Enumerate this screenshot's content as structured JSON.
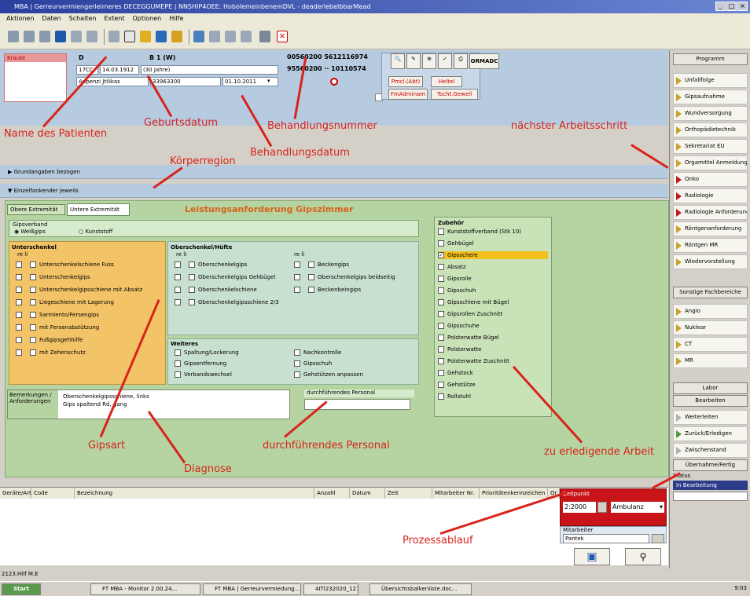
{
  "window": {
    "title": "MBA | Gerreurvermiengerleimeres DECEGGUMEPE | NNSHIP4OEE: HobolemeinbenemDVL - deaderlebelbbarMead",
    "buttons": [
      "_",
      "□",
      "×"
    ]
  },
  "menu": [
    "Aktionen",
    "Daten",
    "Schalten",
    "Extent",
    "Optionen",
    "Hilfe"
  ],
  "patient": {
    "label": "Kraute",
    "name_left": "D",
    "name_right": "B   1 (W)",
    "line2_a": "17CC",
    "line2_b": "14.03.1912",
    "line2_c": "(30 Jahre)",
    "line3_a": "Appenzi Jtilikas",
    "line3_b": "33963300",
    "line3_c": "01.10.2011",
    "case_1": "00560200 5612116974",
    "case_2": "95560200 ·· 10110574",
    "dropdown": "▾"
  },
  "header_buttons": [
    "Pmcl.(Abt)",
    "Heltel",
    "FmAdminam",
    "Tocht.Gewell"
  ],
  "ormadc_label": "ORMADC",
  "sections": {
    "collapsed": "Grundangaben bezogen",
    "expanded": "Einzelfankender jeweils"
  },
  "tabs": [
    "Obere Extremität",
    "Untere Extremität"
  ],
  "form_title": "Leistungsanforderung Gipszimmer",
  "gipsverband": {
    "label": "Gipsverband",
    "opt1": "Weißgips",
    "opt2": "Kunststoff"
  },
  "unterschenkel": {
    "title": "Unterschenkel",
    "cols": "re   li",
    "items": [
      "Unterschenkelschiene Fuss",
      "Unterschenkelgips",
      "Unterschenkelgipsschiene mit Absatz",
      "Liegeschiene mit Lagerung",
      "Sarmiento/Fersengips",
      "mit Fersenabstützung",
      "Fußgipsgehhilfe",
      "mit Zehenschutz"
    ]
  },
  "oberschenkel": {
    "title": "Oberschenkel/Hüfte",
    "cols_a": "re   li",
    "cols_b": "re   li",
    "left_items": [
      "Oberschenkelgips",
      "Oberschenkelgips Gehbügel",
      "Oberschenkelschiene",
      "Oberschenkelgipsschiene 2/3"
    ],
    "right_items": [
      "Beckengips",
      "Oberschenkelgips beidseitig",
      "Beckenbeingips"
    ]
  },
  "weitere": {
    "title": "Weiteres",
    "left_items": [
      "Spaltung/Lockerung",
      "Gipsentfernung",
      "Verbandswechsel"
    ],
    "right_items": [
      "Nachkontrolle",
      "Gipsschuh",
      "Gehstützen anpassen"
    ]
  },
  "zubehoer": {
    "title": "Zubehör",
    "items": [
      "Kunststoffverband (Stk 10)",
      "Gehbügel",
      "Gipsschere",
      "Absatz",
      "Gipsrolle",
      "Gipsschuh",
      "Gipsschiene mit Bügel",
      "Gipsrollen Zuschnitt",
      "Gipsschuhe",
      "Polsterwatte Bügel",
      "Polsterwatte",
      "Polsterwatte Zuschnitt",
      "Gehstock",
      "Gehstütze",
      "Rollstuhl"
    ],
    "checked_index": 2
  },
  "bemerkung": {
    "label": "Bemerkungen / Anforderungen",
    "text": "Oberschenkelgipsschiene, links\nGips spaltend Rd, gang"
  },
  "personal": {
    "label": "durchführendes Personal",
    "value": ""
  },
  "annotations": {
    "name": "Name des Patienten",
    "geburt": "Geburtsdatum",
    "behnr": "Behandlungsnummer",
    "behdat": "Behandlungsdatum",
    "koerper": "Körperregion",
    "naechster": "nächster Arbeitsschritt",
    "gipsart": "Gipsart",
    "diagnose": "Diagnose",
    "personal": "durchführendes Personal",
    "arbeit": "zu erledigende Arbeit",
    "prozess": "Prozessablauf"
  },
  "sidebar": {
    "top_button": "Programm",
    "items": [
      {
        "label": "Unfallfolge",
        "color": "gold"
      },
      {
        "label": "Gipsaufnahme",
        "color": "gold"
      },
      {
        "label": "Wundversorgung",
        "color": "gold"
      },
      {
        "label": "Orthopädietechnik",
        "color": "gold"
      },
      {
        "label": "Sekretariat EU",
        "color": "gold"
      },
      {
        "label": "Orgamittel Anmeldung",
        "color": "gold"
      },
      {
        "label": "Onko",
        "color": "red"
      },
      {
        "label": "Radiologie",
        "color": "red"
      },
      {
        "label": "Radiologie Anforderung",
        "color": "red"
      },
      {
        "label": "Röntgenanforderung",
        "color": "gold"
      },
      {
        "label": "Röntgen MR",
        "color": "gold"
      },
      {
        "label": "Wiedervorstellung",
        "color": "gold"
      }
    ],
    "mid_button": "Sonstige Fachbereiche",
    "items2": [
      {
        "label": "Angio",
        "color": "gold"
      },
      {
        "label": "Nuklear",
        "color": "gold"
      },
      {
        "label": "CT",
        "color": "gold"
      },
      {
        "label": "MR",
        "color": "gold"
      }
    ],
    "btn_a": "Labor",
    "btn_b": "Bearbeiten",
    "items3": [
      {
        "label": "Weiterleiten",
        "color": "grey"
      },
      {
        "label": "Zurück/Erledigen",
        "color": "green"
      },
      {
        "label": "Zwischenstand",
        "color": "grey"
      }
    ],
    "btn_c": "Übernahme/Fertig",
    "status_label": "Status",
    "status_value": "In Bearbeitung"
  },
  "table": {
    "columns": [
      "Geräte/Art",
      "Code",
      "Bezeichnung",
      "Anzahl",
      "Datum",
      "Zeit",
      "Mitarbeiter Nr.",
      "Prioritätenkennzeichen",
      "Or"
    ]
  },
  "process": {
    "time_label": "Zeitpunkt",
    "time_value": "2:2000",
    "type_value": "Ambulanz",
    "worker_label": "Mitarbeiter",
    "worker_value": "Pantek"
  },
  "statusbar": "2123.Hilf M.E",
  "taskbar": {
    "start": "Start",
    "tasks": [
      "FT MBA - Monitor 2.00.24...",
      "FT MBA | Gerreurvermiedung...",
      "4ITI232020_1211",
      "Übersichtsbalkenliste.doc..."
    ],
    "clock": "9:03"
  }
}
